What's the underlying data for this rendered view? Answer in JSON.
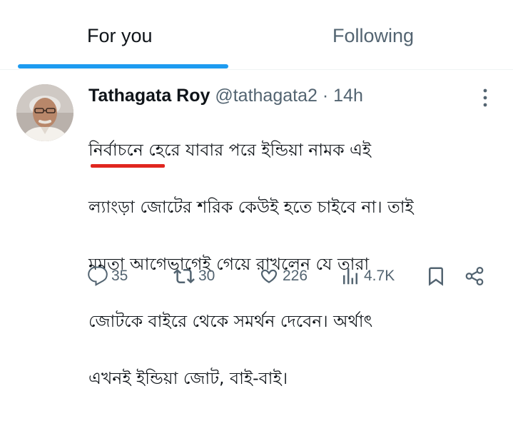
{
  "tabs": {
    "for_you": "For you",
    "following": "Following"
  },
  "tweet": {
    "author_name": "Tathagata Roy",
    "author_handle": "@tathagata2",
    "separator": "·",
    "timestamp": "14h",
    "text_lines": [
      "নির্বাচনে হেরে যাবার পরে ইন্ডিয়া নামক এই",
      "ল্যাংড়া জোটের শরিক কেউই হতে চাইবে না। তাই",
      "মমতা আগেভাগেই গেয়ে রাখলেন যে তারা",
      "জোটকে বাইরে থেকে সমর্থন দেবেন। অর্থাৎ",
      "এখনই ইন্ডিয়া জোট, বাই-বাই।"
    ],
    "highlighted_word": "ল্যাংড়া"
  },
  "actions": {
    "replies": "35",
    "reposts": "30",
    "likes": "226",
    "views": "4.7K"
  },
  "icons": {
    "reply": "reply-icon",
    "repost": "repost-icon",
    "like": "heart-icon",
    "views": "views-icon",
    "bookmark": "bookmark-icon",
    "share": "share-icon",
    "more": "more-vertical-icon"
  },
  "colors": {
    "accent": "#1d9bf0",
    "secondary_text": "#536471",
    "annotation_underline": "#e0261f"
  }
}
